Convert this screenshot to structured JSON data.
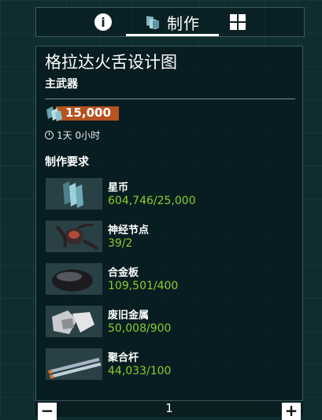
{
  "tabs": {
    "info_icon": "info-icon",
    "craft_label": "制作",
    "grid_icon": "grid-icon"
  },
  "blueprint": {
    "title": "格拉达火舌设计图",
    "subtitle": "主武器",
    "cost": "15,000",
    "time": "1天 0小时"
  },
  "requirements": {
    "heading": "制作要求",
    "items": [
      {
        "name": "星币",
        "amount": "604,746/25,000",
        "icon": "star-coin-icon"
      },
      {
        "name": "神经节点",
        "amount": "39/2",
        "icon": "neural-node-icon"
      },
      {
        "name": "合金板",
        "amount": "109,501/400",
        "icon": "alloy-plate-icon"
      },
      {
        "name": "废旧金属",
        "amount": "50,008/900",
        "icon": "salvage-metal-icon"
      },
      {
        "name": "聚合杆",
        "amount": "44,033/100",
        "icon": "polymer-rod-icon"
      }
    ]
  },
  "quantity": {
    "minus": "−",
    "value": "1",
    "plus": "+"
  },
  "colors": {
    "background": "#0f2c2f",
    "cost_badge": "#b6531f",
    "amount_green": "#8ccc2c"
  }
}
